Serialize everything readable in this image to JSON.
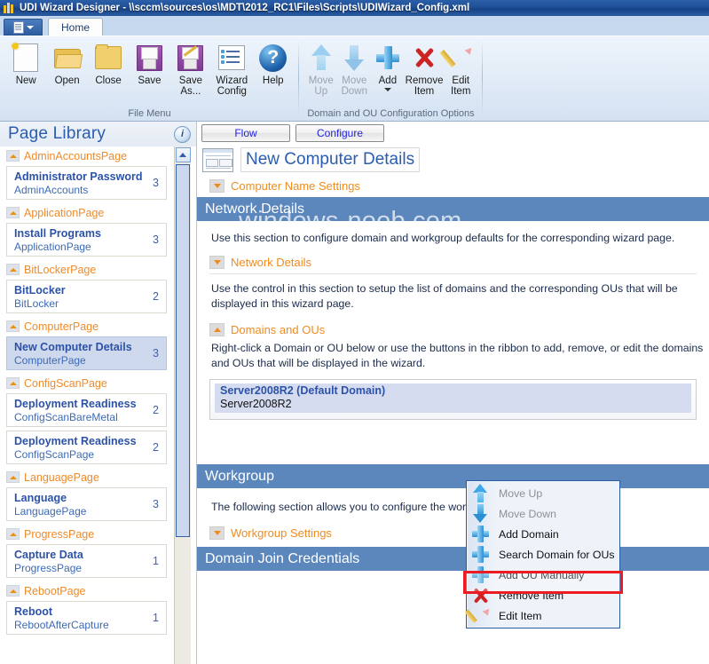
{
  "window": {
    "title": "UDI Wizard Designer - \\\\sccm\\sources\\os\\MDT\\2012_RC1\\Files\\Scripts\\UDIWizard_Config.xml",
    "app_icon": "udi-app-icon"
  },
  "ribbon": {
    "office_button": "file-menu-button",
    "tabs": [
      {
        "label": "Home",
        "active": true
      }
    ],
    "groups": [
      {
        "label": "File Menu",
        "buttons": [
          {
            "label": "New",
            "icon": "new-document-icon",
            "disabled": false,
            "dropdown": false
          },
          {
            "label": "Open",
            "icon": "open-folder-icon",
            "disabled": false,
            "dropdown": false
          },
          {
            "label": "Close",
            "icon": "closed-folder-icon",
            "disabled": false,
            "dropdown": false
          },
          {
            "label": "Save",
            "icon": "floppy-disk-icon",
            "disabled": false,
            "dropdown": false
          },
          {
            "label": "Save\nAs...",
            "icon": "save-as-icon",
            "disabled": false,
            "dropdown": false
          },
          {
            "label": "Wizard\nConfig",
            "icon": "wizard-config-icon",
            "disabled": false,
            "dropdown": false
          },
          {
            "label": "Help",
            "icon": "help-icon",
            "disabled": false,
            "dropdown": false
          }
        ]
      },
      {
        "label": "Domain and OU Configuration Options",
        "buttons": [
          {
            "label": "Move\nUp",
            "icon": "arrow-up-icon",
            "disabled": true,
            "dropdown": false
          },
          {
            "label": "Move\nDown",
            "icon": "arrow-down-icon",
            "disabled": true,
            "dropdown": false
          },
          {
            "label": "Add",
            "icon": "plus-icon",
            "disabled": false,
            "dropdown": true
          },
          {
            "label": "Remove\nItem",
            "icon": "red-x-icon",
            "disabled": false,
            "dropdown": false
          },
          {
            "label": "Edit\nItem",
            "icon": "pencil-icon",
            "disabled": false,
            "dropdown": false
          }
        ]
      }
    ]
  },
  "page_library": {
    "title": "Page Library",
    "info_icon": "info-icon",
    "groups": [
      {
        "name": "AdminAccountsPage",
        "items": [
          {
            "title": "Administrator Password",
            "subtitle": "AdminAccounts",
            "count": "3",
            "selected": false
          }
        ]
      },
      {
        "name": "ApplicationPage",
        "items": [
          {
            "title": "Install Programs",
            "subtitle": "ApplicationPage",
            "count": "3",
            "selected": false
          }
        ]
      },
      {
        "name": "BitLockerPage",
        "items": [
          {
            "title": "BitLocker",
            "subtitle": "BitLocker",
            "count": "2",
            "selected": false
          }
        ]
      },
      {
        "name": "ComputerPage",
        "items": [
          {
            "title": "New Computer Details",
            "subtitle": "ComputerPage",
            "count": "3",
            "selected": true
          }
        ]
      },
      {
        "name": "ConfigScanPage",
        "items": [
          {
            "title": "Deployment Readiness",
            "subtitle": "ConfigScanBareMetal",
            "count": "2",
            "selected": false
          },
          {
            "title": "Deployment Readiness",
            "subtitle": "ConfigScanPage",
            "count": "2",
            "selected": false
          }
        ]
      },
      {
        "name": "LanguagePage",
        "items": [
          {
            "title": "Language",
            "subtitle": "LanguagePage",
            "count": "3",
            "selected": false
          }
        ]
      },
      {
        "name": "ProgressPage",
        "items": [
          {
            "title": "Capture Data",
            "subtitle": "ProgressPage",
            "count": "1",
            "selected": false
          }
        ]
      },
      {
        "name": "RebootPage",
        "items": [
          {
            "title": "Reboot",
            "subtitle": "RebootAfterCapture",
            "count": "1",
            "selected": false
          }
        ]
      }
    ]
  },
  "content": {
    "view_buttons": [
      {
        "label": "Flow"
      },
      {
        "label": "Configure"
      }
    ],
    "page_title": "New Computer Details",
    "page_thumbnail": "page-preview-thumbnail",
    "sections": [
      {
        "label": "Computer Name Settings",
        "expanded": false
      }
    ],
    "network_details": {
      "band": "Network Details",
      "intro": "Use this section to configure domain and workgroup defaults for the corresponding wizard page.",
      "toggle": "Network Details",
      "description": "Use the control in this section to setup the list of domains and the corresponding OUs that will be displayed in this wizard page.",
      "domains_toggle": "Domains and OUs",
      "domains_help": "Right-click a Domain or OU below or use the buttons in the ribbon to add, remove, or edit the domains and OUs that will be displayed in the wizard.",
      "domain_rows": [
        {
          "primary": "Server2008R2 (Default Domain)",
          "secondary": "Server2008R2",
          "selected": true
        }
      ]
    },
    "workgroup": {
      "band": "Workgroup",
      "intro": "The following section allows you to configure the workgroup.",
      "toggle": "Workgroup Settings"
    },
    "domain_join": {
      "band": "Domain Join Credentials"
    },
    "watermark": "windows-noob.com"
  },
  "context_menu": {
    "items": [
      {
        "label": "Move Up",
        "icon": "arrow-up-icon",
        "disabled": true,
        "highlighted": false
      },
      {
        "label": "Move Down",
        "icon": "arrow-down-icon",
        "disabled": true,
        "highlighted": false
      },
      {
        "label": "Add Domain",
        "icon": "plus-icon",
        "disabled": false,
        "highlighted": false
      },
      {
        "label": "Search Domain for OUs",
        "icon": "plus-icon",
        "disabled": false,
        "highlighted": false
      },
      {
        "label": "Add OU Manually",
        "icon": "plus-icon",
        "disabled": false,
        "highlighted": true
      },
      {
        "label": "Remove Item",
        "icon": "red-x-icon",
        "disabled": false,
        "highlighted": false
      },
      {
        "label": "Edit Item",
        "icon": "pencil-icon",
        "disabled": false,
        "highlighted": false
      }
    ],
    "highlight_color": "#ec1c24"
  },
  "colors": {
    "titlebar": "#1f4f96",
    "band": "#5b87bd",
    "accent_orange": "#ee8c22",
    "link_blue": "#2c52a8",
    "selection": "#cfd9ee"
  }
}
